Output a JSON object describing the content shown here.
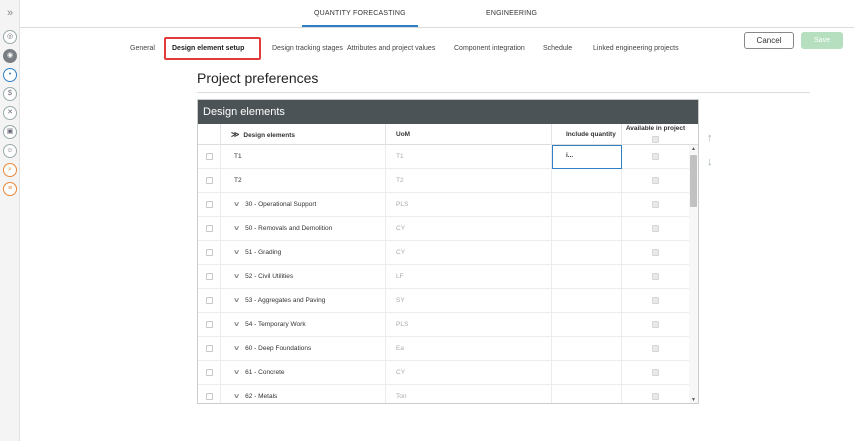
{
  "rail": {
    "expand": "»",
    "items": [
      {
        "name": "rail-home-icon",
        "glyph": "◎",
        "style": ""
      },
      {
        "name": "rail-quantity-icon",
        "glyph": "◉",
        "style": "active"
      },
      {
        "name": "rail-target-icon",
        "glyph": "•",
        "style": "blue"
      },
      {
        "name": "rail-dollar-icon",
        "glyph": "$",
        "style": ""
      },
      {
        "name": "rail-cross-icon",
        "glyph": "✕",
        "style": ""
      },
      {
        "name": "rail-box-icon",
        "glyph": "▣",
        "style": ""
      },
      {
        "name": "rail-people-icon",
        "glyph": "☺",
        "style": ""
      },
      {
        "name": "rail-search-icon",
        "glyph": "⌕",
        "style": "orange"
      },
      {
        "name": "rail-document-icon",
        "glyph": "≡",
        "style": "orange"
      }
    ]
  },
  "topnav": {
    "quantity_forecasting": "QUANTITY FORECASTING",
    "engineering": "ENGINEERING"
  },
  "subtabs": {
    "general": "General",
    "design_element_setup": "Design element setup",
    "design_tracking_stages": "Design tracking stages",
    "attributes": "Attributes and project values",
    "component_integration": "Component integration",
    "schedule": "Schedule",
    "linked_projects": "Linked engineering projects"
  },
  "actions": {
    "cancel": "Cancel",
    "save": "Save"
  },
  "page": {
    "title": "Project preferences"
  },
  "panel": {
    "title": "Design elements",
    "columns": {
      "design_elements": "Design elements",
      "uom": "UoM",
      "include_quantity": "Include quantity i...",
      "available": "Available in project"
    },
    "sort_icon": "≫",
    "rows": [
      {
        "name": "T1",
        "uom": "T1",
        "expandable": false
      },
      {
        "name": "T2",
        "uom": "T2",
        "expandable": false
      },
      {
        "name": "30 - Operational Support",
        "uom": "PLS",
        "expandable": true
      },
      {
        "name": "50 - Removals and Demolition",
        "uom": "CY",
        "expandable": true
      },
      {
        "name": "51 - Grading",
        "uom": "CY",
        "expandable": true
      },
      {
        "name": "52 - Civil Utilities",
        "uom": "LF",
        "expandable": true
      },
      {
        "name": "53 - Aggregates and Paving",
        "uom": "SY",
        "expandable": true
      },
      {
        "name": "54 - Temporary Work",
        "uom": "PLS",
        "expandable": true
      },
      {
        "name": "60 - Deep Foundations",
        "uom": "Ea",
        "expandable": true
      },
      {
        "name": "61 - Concrete",
        "uom": "CY",
        "expandable": true
      },
      {
        "name": "62 - Metals",
        "uom": "Ton",
        "expandable": true
      }
    ]
  },
  "move": {
    "up": "↑",
    "down": "↓"
  }
}
